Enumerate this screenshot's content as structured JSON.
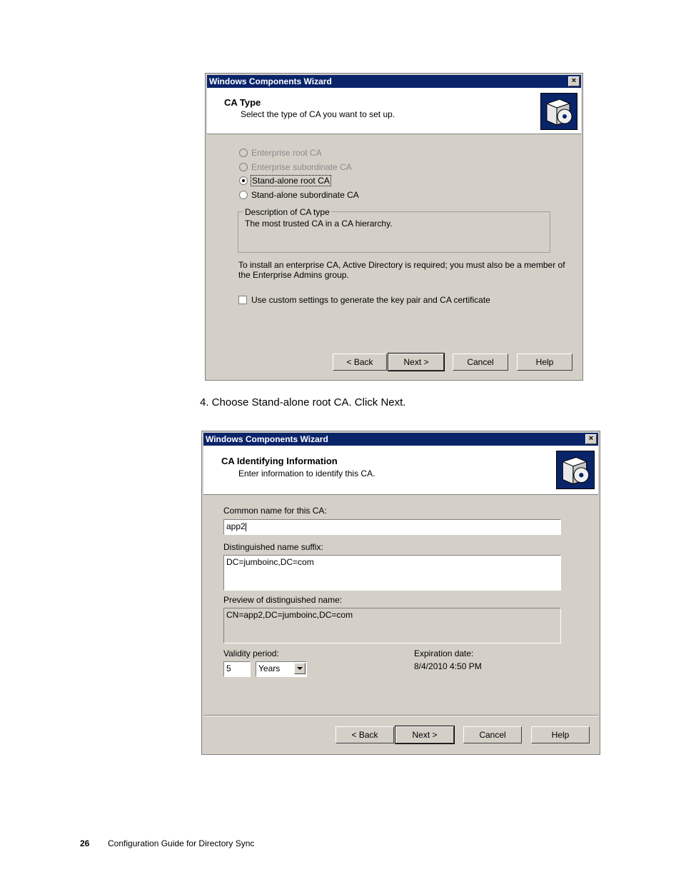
{
  "dialog1": {
    "title": "Windows Components Wizard",
    "close": "×",
    "header_title": "CA Type",
    "header_subtitle": "Select the type of CA you want to set up.",
    "options": [
      {
        "label": "Enterprise root CA",
        "enabled": false,
        "selected": false
      },
      {
        "label": "Enterprise subordinate CA",
        "enabled": false,
        "selected": false
      },
      {
        "label": "Stand-alone root CA",
        "enabled": true,
        "selected": true
      },
      {
        "label": "Stand-alone subordinate CA",
        "enabled": true,
        "selected": false
      }
    ],
    "description_legend": "Description of CA type",
    "description_text": "The most trusted CA in a CA hierarchy.",
    "info_line1": "To install an enterprise CA, Active Directory is required; you must also be a member of",
    "info_line2": "the Enterprise Admins group.",
    "custom_settings_label": "Use custom settings to generate the key pair and CA certificate",
    "buttons": {
      "back": "< Back",
      "next": "Next >",
      "cancel": "Cancel",
      "help": "Help"
    }
  },
  "step_caption": "4.   Choose Stand-alone root CA. Click Next.",
  "dialog2": {
    "title": "Windows Components Wizard",
    "close": "×",
    "header_title": "CA Identifying Information",
    "header_subtitle": "Enter information to identify this CA.",
    "common_name_label": "Common name for this CA:",
    "common_name_value": "app2",
    "dn_suffix_label": "Distinguished name suffix:",
    "dn_suffix_value": "DC=jumboinc,DC=com",
    "preview_label": "Preview of distinguished name:",
    "preview_value": "CN=app2,DC=jumboinc,DC=com",
    "validity_label": "Validity period:",
    "validity_value": "5",
    "validity_unit": "Years",
    "expiration_label": "Expiration date:",
    "expiration_value": "8/4/2010 4:50 PM",
    "buttons": {
      "back": "< Back",
      "next": "Next >",
      "cancel": "Cancel",
      "help": "Help"
    }
  },
  "footer": {
    "page_number": "26",
    "doc_title": "Configuration Guide for Directory Sync"
  }
}
